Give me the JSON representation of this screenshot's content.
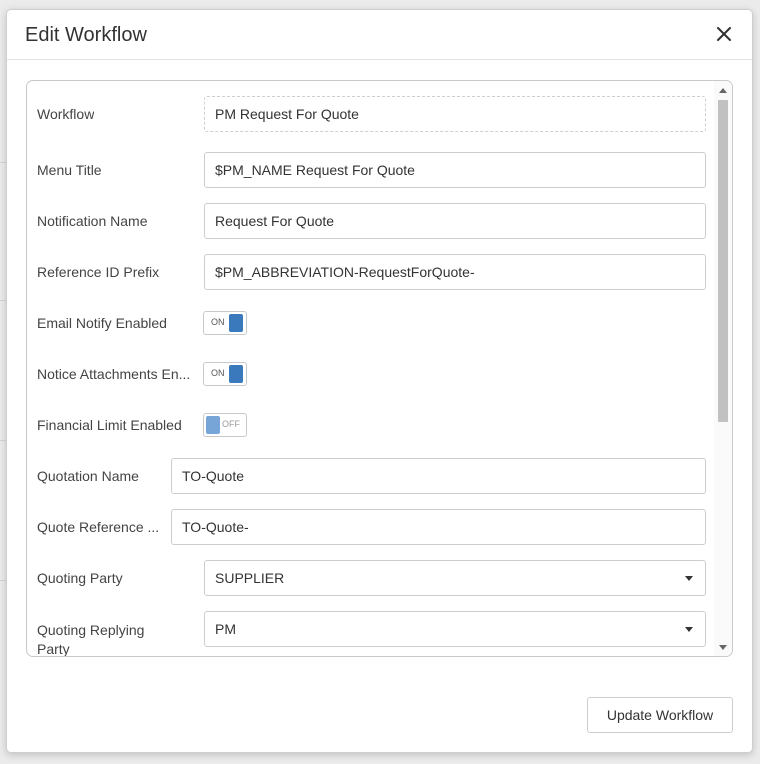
{
  "dialog": {
    "title": "Edit Workflow"
  },
  "form": {
    "workflow": {
      "label": "Workflow",
      "value": "PM Request For Quote"
    },
    "menu_title": {
      "label": "Menu Title",
      "value": "$PM_NAME Request For Quote"
    },
    "notification_name": {
      "label": "Notification Name",
      "value": "Request For Quote"
    },
    "reference_id_prefix": {
      "label": "Reference ID Prefix",
      "value": "$PM_ABBREVIATION-RequestForQuote-"
    },
    "email_notify_enabled": {
      "label": "Email Notify Enabled",
      "state": "ON"
    },
    "notice_attachments_enabled": {
      "label": "Notice Attachments En...",
      "state": "ON"
    },
    "financial_limit_enabled": {
      "label": "Financial Limit Enabled",
      "state": "OFF"
    },
    "quotation_name": {
      "label": "Quotation Name",
      "value": "TO-Quote"
    },
    "quote_reference": {
      "label": "Quote Reference ...",
      "value": "TO-Quote-"
    },
    "quoting_party": {
      "label": "Quoting Party",
      "value": "SUPPLIER"
    },
    "quoting_replying_party": {
      "label": "Quoting Replying Party",
      "value": "PM"
    }
  },
  "footer": {
    "update_label": "Update Workflow"
  },
  "colors": {
    "toggle_on": "#3a79bb",
    "toggle_off": "#77a5d8"
  }
}
